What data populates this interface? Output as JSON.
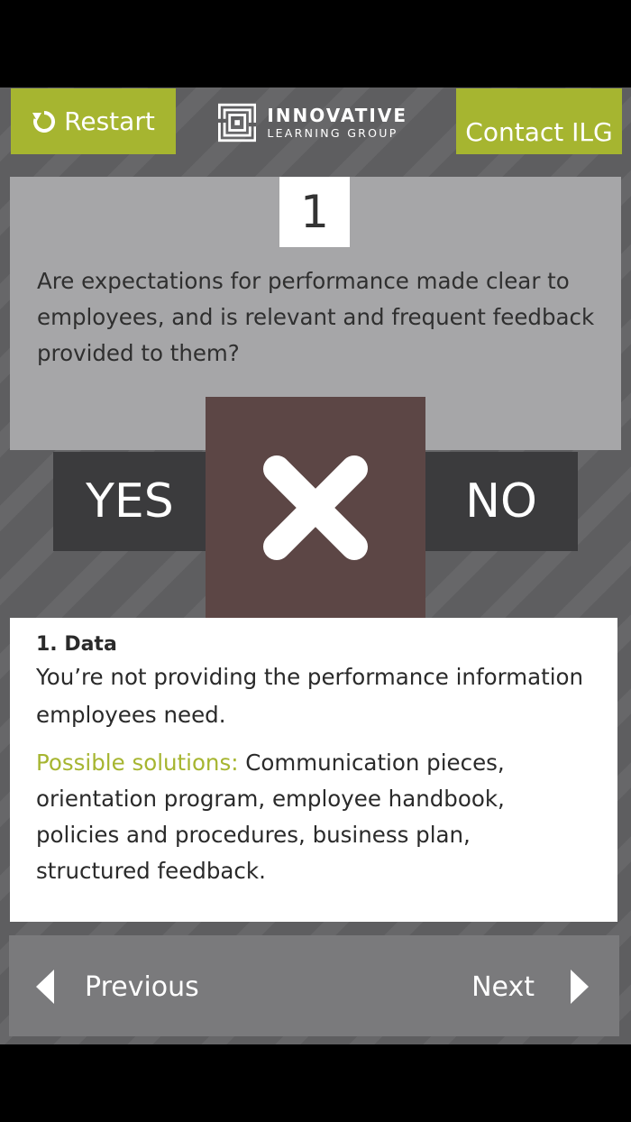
{
  "header": {
    "restart_label": "Restart",
    "contact_label": "Contact ILG",
    "logo_line1": "INNOVATIVE",
    "logo_line2": "LEARNING GROUP",
    "accent_color": "#a6b530"
  },
  "question": {
    "number": "1",
    "text": "Are expectations for performance made clear to employees, and is relevant and frequent feedback provided to them?"
  },
  "choices": {
    "yes_label": "YES",
    "no_label": "NO",
    "selected_icon": "close-x-icon"
  },
  "answer": {
    "title": "1. Data",
    "description": "You’re not providing the performance information employees need.",
    "solutions_label": "Possible solutions:",
    "solutions_text": " Communication pieces, orientation program, employee handbook, policies and procedures, business plan, structured feedback."
  },
  "navigation": {
    "previous_label": "Previous",
    "next_label": "Next"
  }
}
